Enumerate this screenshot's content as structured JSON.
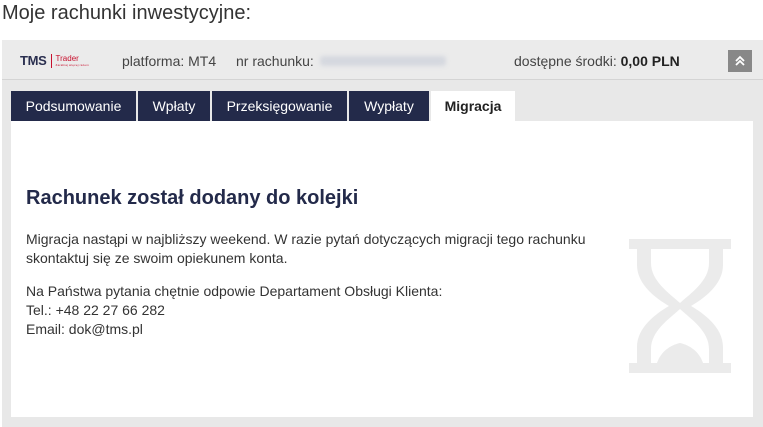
{
  "page": {
    "title": "Moje rachunki inwestycyjne:"
  },
  "account_bar": {
    "logo_main": "TMS",
    "logo_sub": "Trader",
    "logo_tagline": "Zarabiaj więcej razem",
    "platform": "platforma: MT4",
    "account_label": "nr rachunku:",
    "funds_label": "dostępne środki:",
    "funds_value": "0,00 PLN"
  },
  "tabs": [
    {
      "label": "Podsumowanie",
      "active": false
    },
    {
      "label": "Wpłaty",
      "active": false
    },
    {
      "label": "Przeksięgowanie",
      "active": false
    },
    {
      "label": "Wypłaty",
      "active": false
    },
    {
      "label": "Migracja",
      "active": true
    }
  ],
  "content": {
    "heading": "Rachunek został dodany do kolejki",
    "message": "Migracja nastąpi w najbliższy weekend. W razie pytań dotyczących migracji tego rachunku skontaktuj się ze swoim opiekunem konta.",
    "support_intro": "Na Państwa pytania chętnie odpowie Departament Obsługi Klienta:",
    "phone": "Tel.: +48 22 27 66 282",
    "email": "Email: dok@tms.pl"
  },
  "colors": {
    "navy": "#232a4a",
    "brand_red": "#c8102e",
    "hourglass": "#ebebeb"
  },
  "icons": {
    "collapse": "chevron-double-up-icon",
    "status": "hourglass-icon"
  }
}
